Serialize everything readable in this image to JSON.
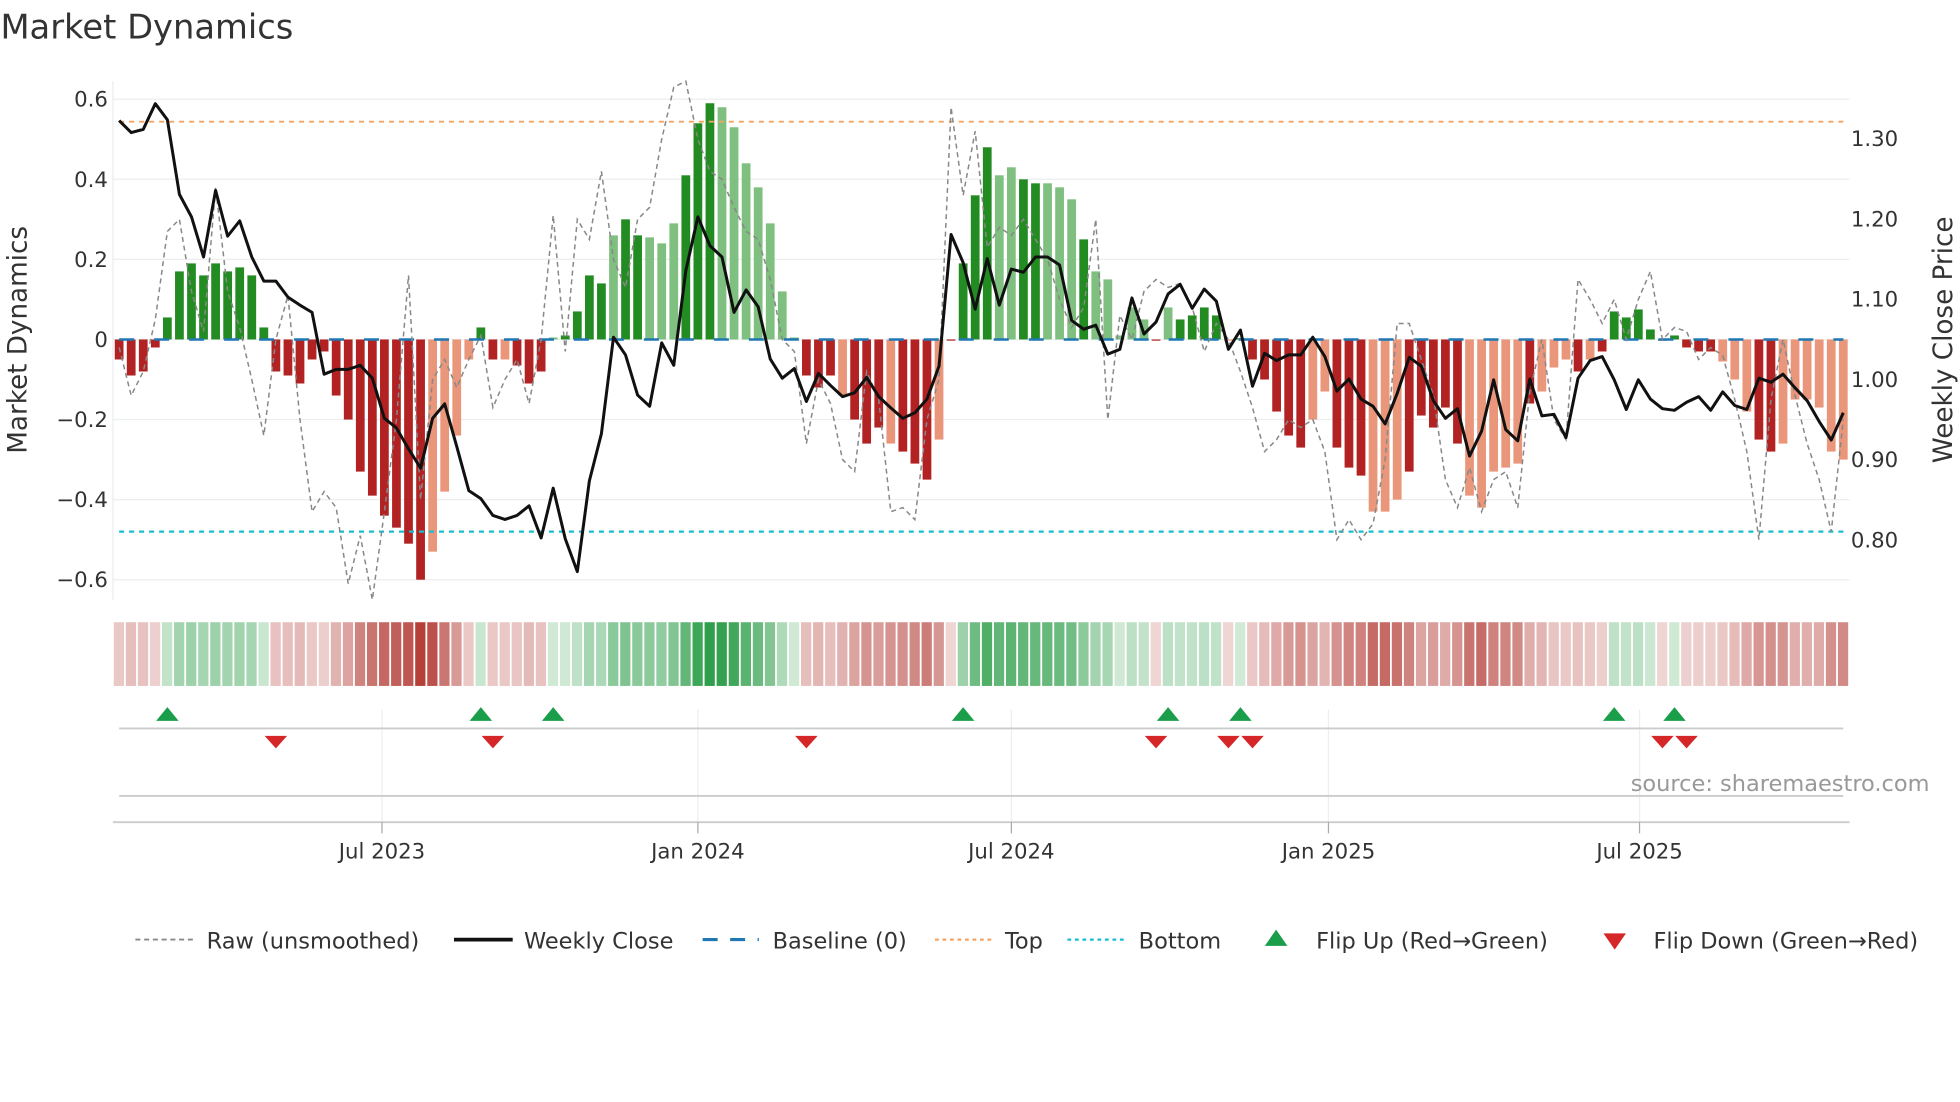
{
  "chart_data": {
    "type": "bar",
    "title": "Market Dynamics",
    "ylabel": "Market Dynamics",
    "y2label": "Weekly Close Price",
    "ylim": [
      -0.65,
      0.645
    ],
    "y2lim": [
      0.724,
      1.37
    ],
    "yticks": [
      0.6,
      0.4,
      0.2,
      0,
      -0.2,
      -0.4,
      -0.6
    ],
    "ytick_labels": [
      "0.6",
      "0.4",
      "0.2",
      "0",
      "−0.2",
      "−0.4",
      "−0.6"
    ],
    "y2ticks": [
      1.3,
      1.2,
      1.1,
      1.0,
      0.9,
      0.8
    ],
    "y2tick_labels": [
      "1.30",
      "1.20",
      "1.10",
      "1.00",
      "0.90",
      "0.80"
    ],
    "xticks": [
      {
        "week": 21.8,
        "label": "Jul 2023"
      },
      {
        "week": 48.0,
        "label": "Jan 2024"
      },
      {
        "week": 74.0,
        "label": "Jul 2024"
      },
      {
        "week": 100.3,
        "label": "Jan 2025"
      },
      {
        "week": 126.1,
        "label": "Jul 2025"
      }
    ],
    "top_level": 0.544,
    "bottom_level": -0.48,
    "baseline": 0,
    "grid": true,
    "bars": [
      -0.05,
      -0.09,
      -0.08,
      -0.02,
      0.055,
      0.17,
      0.19,
      0.16,
      0.19,
      0.17,
      0.18,
      0.16,
      0.03,
      -0.08,
      -0.09,
      -0.11,
      -0.05,
      -0.03,
      -0.14,
      -0.2,
      -0.33,
      -0.39,
      -0.44,
      -0.47,
      -0.51,
      -0.6,
      -0.53,
      -0.38,
      -0.24,
      -0.05,
      0.03,
      -0.05,
      -0.05,
      -0.065,
      -0.11,
      -0.08,
      0.005,
      0.01,
      0.07,
      0.16,
      0.14,
      0.26,
      0.3,
      0.26,
      0.255,
      0.24,
      0.29,
      0.41,
      0.54,
      0.59,
      0.58,
      0.53,
      0.44,
      0.38,
      0.29,
      0.12,
      0.005,
      -0.09,
      -0.12,
      -0.09,
      -0.14,
      -0.2,
      -0.26,
      -0.22,
      -0.26,
      -0.28,
      -0.31,
      -0.35,
      -0.25,
      -0.003,
      0.19,
      0.36,
      0.48,
      0.41,
      0.43,
      0.4,
      0.39,
      0.39,
      0.38,
      0.35,
      0.25,
      0.17,
      0.15,
      0.01,
      0.08,
      0.05,
      -0.003,
      0.08,
      0.05,
      0.06,
      0.08,
      0.06,
      -0.003,
      0.003,
      -0.05,
      -0.1,
      -0.18,
      -0.24,
      -0.27,
      -0.2,
      -0.13,
      -0.27,
      -0.32,
      -0.34,
      -0.43,
      -0.43,
      -0.4,
      -0.33,
      -0.19,
      -0.22,
      -0.17,
      -0.26,
      -0.39,
      -0.42,
      -0.33,
      -0.32,
      -0.31,
      -0.16,
      -0.13,
      -0.07,
      -0.05,
      -0.08,
      -0.05,
      -0.03,
      0.07,
      0.055,
      0.075,
      0.025,
      -0.003,
      0.01,
      -0.02,
      -0.03,
      -0.03,
      -0.055,
      -0.1,
      -0.18,
      -0.25,
      -0.28,
      -0.26,
      -0.15,
      -0.15,
      -0.17,
      -0.28,
      -0.3
    ],
    "bar_strength": "ddddddddddddddddddddddddddllllddldddlddddlddllldddllllllldddldddldddlddddllddllldllllldlddddlddddddlldddllldddddllllldllldlddddddddddllldd",
    "raw": [
      -0.02,
      -0.14,
      -0.08,
      0.05,
      0.27,
      0.3,
      0.12,
      0.02,
      0.38,
      0.12,
      0.03,
      -0.1,
      -0.24,
      0.0,
      0.11,
      -0.2,
      -0.43,
      -0.38,
      -0.42,
      -0.61,
      -0.49,
      -0.65,
      -0.43,
      -0.2,
      0.16,
      -0.4,
      -0.1,
      -0.05,
      -0.12,
      -0.05,
      0.01,
      -0.17,
      -0.1,
      -0.05,
      -0.16,
      0.0,
      0.31,
      -0.03,
      0.3,
      0.25,
      0.42,
      0.2,
      0.13,
      0.3,
      0.33,
      0.5,
      0.63,
      0.65,
      0.5,
      0.42,
      0.4,
      0.33,
      0.27,
      0.25,
      0.15,
      0.0,
      -0.03,
      -0.26,
      -0.1,
      -0.16,
      -0.3,
      -0.33,
      -0.08,
      -0.15,
      -0.43,
      -0.42,
      -0.45,
      -0.2,
      -0.1,
      0.58,
      0.36,
      0.52,
      0.23,
      0.28,
      0.26,
      0.3,
      0.25,
      0.2,
      0.1,
      0.03,
      0.08,
      0.3,
      -0.2,
      0.06,
      0.0,
      0.12,
      0.15,
      0.13,
      0.14,
      0.08,
      -0.03,
      0.04,
      0.0,
      -0.08,
      -0.17,
      -0.28,
      -0.25,
      -0.2,
      -0.22,
      -0.2,
      -0.28,
      -0.5,
      -0.45,
      -0.5,
      -0.46,
      -0.3,
      0.04,
      0.04,
      -0.05,
      -0.14,
      -0.35,
      -0.42,
      -0.32,
      -0.43,
      -0.35,
      -0.33,
      -0.42,
      -0.13,
      0.0,
      -0.2,
      -0.25,
      0.15,
      0.1,
      0.04,
      0.1,
      0.0,
      0.1,
      0.17,
      0.0,
      0.03,
      0.02,
      -0.05,
      -0.02,
      -0.04,
      -0.15,
      -0.28,
      -0.5,
      -0.15,
      0.0,
      -0.14,
      -0.26,
      -0.35,
      -0.48,
      -0.2
    ],
    "weekly_close": [
      1.321,
      1.306,
      1.31,
      1.342,
      1.322,
      1.229,
      1.201,
      1.151,
      1.234,
      1.177,
      1.196,
      1.151,
      1.121,
      1.121,
      1.101,
      1.091,
      1.082,
      1.005,
      1.011,
      1.011,
      1.016,
      1.0,
      0.95,
      0.938,
      0.912,
      0.888,
      0.95,
      0.968,
      0.915,
      0.86,
      0.85,
      0.829,
      0.824,
      0.829,
      0.841,
      0.801,
      0.863,
      0.8,
      0.759,
      0.872,
      0.931,
      1.051,
      1.029,
      0.979,
      0.965,
      1.044,
      1.016,
      1.134,
      1.201,
      1.165,
      1.151,
      1.082,
      1.11,
      1.089,
      1.024,
      1.0,
      1.012,
      0.971,
      1.006,
      0.991,
      0.977,
      0.982,
      1.001,
      0.977,
      0.963,
      0.95,
      0.957,
      0.974,
      1.015,
      1.179,
      1.144,
      1.086,
      1.149,
      1.091,
      1.136,
      1.132,
      1.151,
      1.151,
      1.141,
      1.072,
      1.061,
      1.066,
      1.03,
      1.036,
      1.1,
      1.055,
      1.07,
      1.105,
      1.117,
      1.087,
      1.111,
      1.096,
      1.036,
      1.06,
      0.99,
      1.031,
      1.022,
      1.029,
      1.029,
      1.051,
      1.027,
      0.984,
      0.999,
      0.974,
      0.965,
      0.943,
      0.981,
      1.026,
      1.015,
      0.972,
      0.95,
      0.962,
      0.903,
      0.934,
      0.998,
      0.936,
      0.922,
      0.999,
      0.953,
      0.955,
      0.926,
      1.0,
      1.022,
      1.027,
      0.998,
      0.961,
      0.998,
      0.974,
      0.962,
      0.96,
      0.97,
      0.977,
      0.96,
      0.983,
      0.966,
      0.961,
      1.0,
      0.995,
      1.005,
      0.988,
      0.972,
      0.946,
      0.923,
      0.957
    ],
    "flip_up_weeks": [
      4,
      30,
      36,
      70,
      87,
      93,
      124,
      129
    ],
    "flip_down_weeks": [
      13,
      31,
      57,
      86,
      92,
      94,
      128,
      130
    ],
    "legend": {
      "placement": "bottom",
      "entries": [
        "Raw (unsmoothed)",
        "Weekly Close",
        "Baseline (0)",
        "Top",
        "Bottom",
        "Flip Up (Red→Green)",
        "Flip Down (Green→Red)"
      ]
    },
    "source": "source: sharemaestro.com",
    "colors": {
      "strong_green": "#228b22",
      "weak_green": "#7fbf7f",
      "strong_red": "#b22222",
      "weak_red": "#e9967a",
      "close": "#111111",
      "raw": "#888888",
      "baseline": "#1f77b4",
      "top": "#f4a460",
      "bottom": "#17becf",
      "flip_up": "#1a9e4a",
      "flip_down": "#d62728",
      "strip_green": "#2e9e4a",
      "strip_red": "#b5403a"
    }
  }
}
